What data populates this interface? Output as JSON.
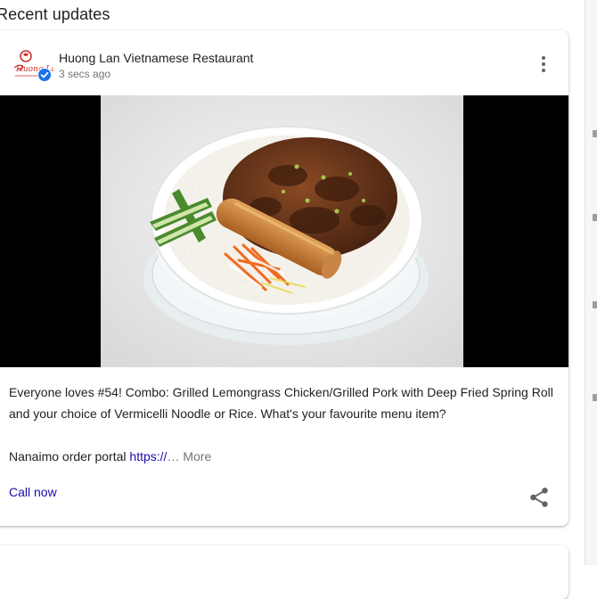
{
  "section": {
    "title": "Recent updates"
  },
  "post": {
    "business_name": "Huong Lan Vietnamese Restaurant",
    "timestamp": "3 secs ago",
    "logo_text": "Huong Lan",
    "verified": true,
    "body": "Everyone loves #54! Combo: Grilled Lemongrass Chicken/Grilled Pork with Deep Fried Spring Roll and your choice of Vermicelli Noodle or Rice. What's your favourite menu item?",
    "portal_label": "Nanaimo order portal",
    "portal_link": "https://",
    "ellipsis": "…",
    "more_label": "More",
    "call_label": "Call now",
    "photo": "bowl of vermicelli with grilled pork, spring roll, cucumber and pickled carrot"
  },
  "icons": {
    "menu": "more-vert-icon",
    "share": "share-icon",
    "verified": "verified-check-icon"
  },
  "colors": {
    "link": "#1a0dab",
    "secondary_text": "#70757a",
    "verified_badge": "#1a73e8",
    "logo_red": "#d32f2f"
  }
}
